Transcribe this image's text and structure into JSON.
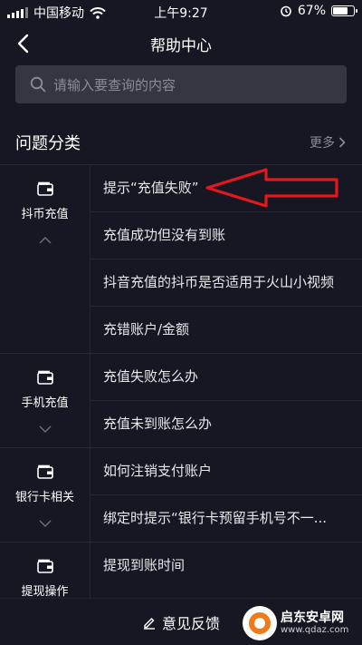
{
  "status_bar": {
    "carrier": "中国移动",
    "time": "上午9:27",
    "battery_percent_text": "67%",
    "battery_level": 0.67,
    "icons": [
      "signal-icon",
      "wifi-icon",
      "alarm-icon",
      "battery-icon"
    ]
  },
  "nav": {
    "title": "帮助中心",
    "back_icon": "chevron-left-icon"
  },
  "search": {
    "placeholder": "请输入要查询的内容",
    "value": "",
    "icon": "search-icon"
  },
  "section": {
    "title": "问题分类",
    "more_label": "更多"
  },
  "categories": [
    {
      "label": "抖币充值",
      "icon": "wallet-icon",
      "chevron": "up",
      "items": [
        "提示“充值失败”",
        "充值成功但没有到账",
        "抖音充值的抖币是否适用于火山小视频",
        "充错账户/金额"
      ]
    },
    {
      "label": "手机充值",
      "icon": "wallet-icon",
      "chevron": "down",
      "items": [
        "充值失败怎么办",
        "充值未到账怎么办"
      ]
    },
    {
      "label": "银行卡相关",
      "icon": "wallet-icon",
      "chevron": "down",
      "items": [
        "如何注销支付账户",
        "绑定时提示“银行卡预留手机号不一..."
      ]
    },
    {
      "label": "提现操作",
      "icon": "wallet-icon",
      "chevron": "down",
      "items": [
        "提现到账时间"
      ]
    }
  ],
  "bottom": {
    "feedback_label": "意见反馈",
    "icon": "edit-icon"
  },
  "annotation": {
    "arrow_color": "#e0191f"
  },
  "watermark": {
    "name": "启东安卓网",
    "domain": "www.qdaz.com"
  },
  "colors": {
    "background": "#161723",
    "search_bg": "#353642",
    "divider": "#262733",
    "muted_text": "#8b8c94"
  }
}
